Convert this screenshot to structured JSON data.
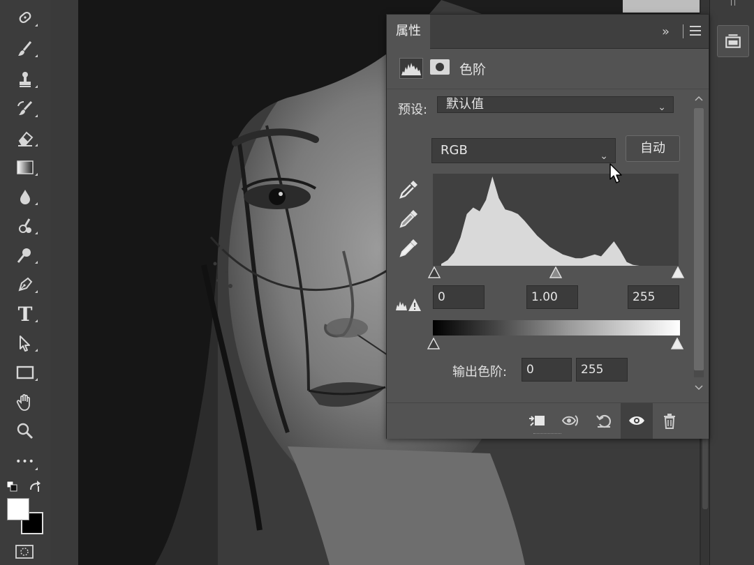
{
  "toolbar": {
    "tools": [
      {
        "name": "spot-healing-brush-icon"
      },
      {
        "name": "brush-icon"
      },
      {
        "name": "clone-stamp-icon"
      },
      {
        "name": "history-brush-icon"
      },
      {
        "name": "eraser-icon"
      },
      {
        "name": "gradient-icon"
      },
      {
        "name": "blur-icon"
      },
      {
        "name": "smudge-icon"
      },
      {
        "name": "dodge-icon"
      },
      {
        "name": "pen-icon"
      },
      {
        "name": "type-icon"
      },
      {
        "name": "path-selection-icon"
      },
      {
        "name": "rectangle-icon"
      },
      {
        "name": "hand-icon"
      },
      {
        "name": "zoom-icon"
      },
      {
        "name": "more-tools-icon"
      }
    ],
    "type_tool_glyph": "T",
    "more_glyph": "•••"
  },
  "properties_panel": {
    "tab_label": "属性",
    "collapse_glyph": "»",
    "adjustment_title": "色阶",
    "preset_label": "预设:",
    "preset_value": "默认值",
    "channel_value": "RGB",
    "auto_button": "自动",
    "input_levels": {
      "black": "0",
      "gamma": "1.00",
      "white": "255"
    },
    "output_label": "输出色阶:",
    "output_levels": {
      "black": "0",
      "white": "255"
    }
  },
  "colors": {
    "panel_bg": "#535353",
    "toolbar_bg": "#3c3c3c",
    "field_bg": "#3b3b3b",
    "histogram_fill": "#d9d9d9"
  },
  "histogram_data": {
    "bins_0_255_step_8": [
      2,
      6,
      14,
      30,
      55,
      62,
      58,
      70,
      95,
      72,
      60,
      58,
      55,
      48,
      40,
      32,
      26,
      20,
      16,
      12,
      10,
      8,
      8,
      10,
      12,
      10,
      18,
      26,
      16,
      4,
      1,
      0
    ],
    "peak_note": "brightest-bin"
  }
}
